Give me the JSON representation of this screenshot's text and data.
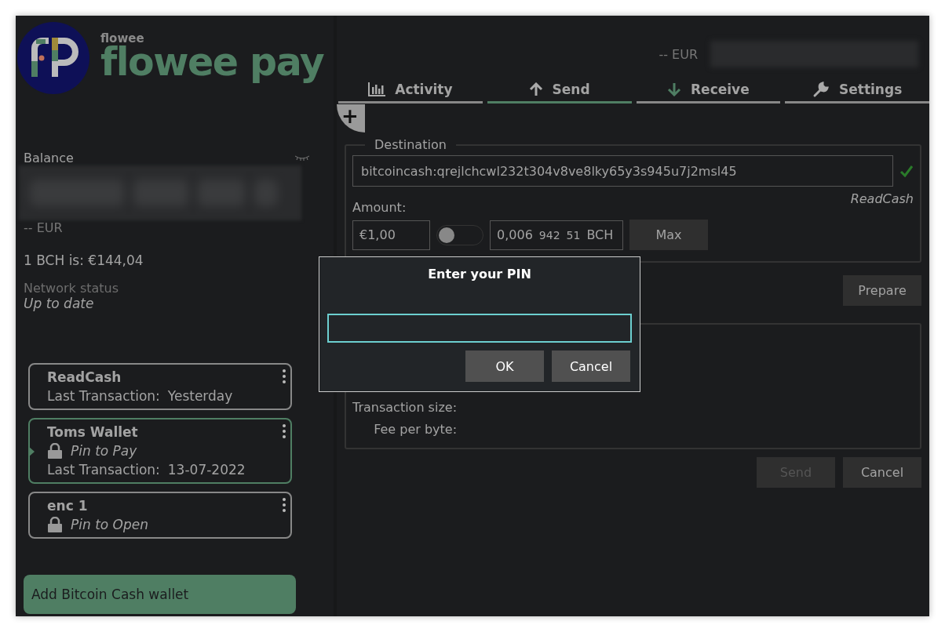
{
  "logo": {
    "small": "flowee",
    "large": "flowee pay"
  },
  "sidebar": {
    "balance_label": "Balance",
    "balance_hidden": true,
    "balance_fiat": "-- EUR",
    "rate": "1 BCH is: €144,04",
    "network_label": "Network status",
    "network_status": "Up to date",
    "wallets": [
      {
        "name": "ReadCash",
        "selected": false,
        "last_label": "Last Transaction:",
        "last_value": "Yesterday"
      },
      {
        "name": "Toms Wallet",
        "selected": true,
        "lock_text": "Pin to Pay",
        "last_label": "Last Transaction:",
        "last_value": "13-07-2022"
      },
      {
        "name": "enc 1",
        "selected": false,
        "lock_text": "Pin to Open"
      }
    ],
    "add_wallet_button": "Add Bitcoin Cash wallet"
  },
  "header": {
    "fiat_balance": "-- EUR"
  },
  "tabs": [
    {
      "label": "Activity",
      "selected": false
    },
    {
      "label": "Send",
      "selected": true
    },
    {
      "label": "Receive",
      "selected": false
    },
    {
      "label": "Settings",
      "selected": false
    }
  ],
  "add_button": "+",
  "send": {
    "destination_legend": "Destination",
    "address": "bitcoincash:qrejlchcwl232t304v8ve8lky65y3s945u7j2msl45",
    "address_valid": true,
    "wallet_name": "ReadCash",
    "amount_label": "Amount:",
    "fiat_amount": "€1,00",
    "toggle_on": false,
    "bch_amount": [
      "0,006",
      "942",
      "51"
    ],
    "bch_unit": "BCH",
    "max_button": "Max",
    "prepare_button": "Prepare",
    "summary_labels": [
      "Transaction size:",
      "Fee per byte:"
    ],
    "send_button": {
      "label": "Send",
      "disabled": true
    },
    "cancel_button": "Cancel"
  },
  "dialog": {
    "title": "Enter your PIN",
    "buttons": [
      "OK",
      "Cancel"
    ]
  }
}
